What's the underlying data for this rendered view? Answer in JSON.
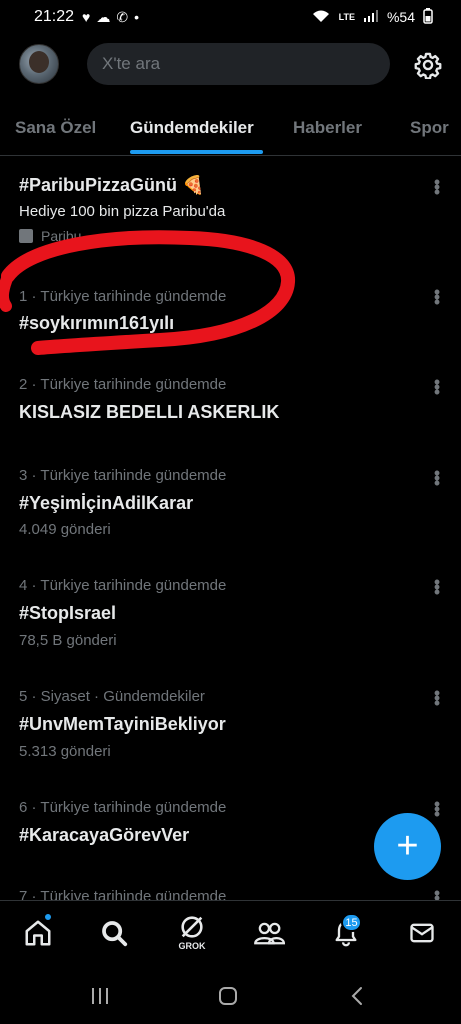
{
  "status_bar": {
    "time": "21:22",
    "battery": "%54",
    "network": "LTE"
  },
  "search": {
    "placeholder": "X'te ara"
  },
  "tabs": [
    {
      "label": "Sana Özel"
    },
    {
      "label": "Gündemdekiler"
    },
    {
      "label": "Haberler"
    },
    {
      "label": "Spor"
    }
  ],
  "trends": [
    {
      "title": "#ParibuPizzaGünü 🍕",
      "subtitle": "Hediye 100 bin pizza Paribu'da",
      "promoted": "Paribu"
    },
    {
      "context": "1 · Türkiye tarihinde gündemde",
      "title": "#soykırımın161yılı"
    },
    {
      "context": "2 · Türkiye tarihinde gündemde",
      "title": "KISLASIZ BEDELLI ASKERLIK"
    },
    {
      "context": "3 · Türkiye tarihinde gündemde",
      "title": "#YeşimİçinAdilKarar",
      "posts": "4.049 gönderi"
    },
    {
      "context": "4 · Türkiye tarihinde gündemde",
      "title": "#StopIsrael",
      "posts": "78,5 B gönderi"
    },
    {
      "context": "5 · Siyaset · Gündemdekiler",
      "title": "#UnvMemTayiniBekliyor",
      "posts": "5.313 gönderi"
    },
    {
      "context": "6 · Türkiye tarihinde gündemde",
      "title": "#KaracayaGörevVer"
    },
    {
      "context": "7 · Türkiye tarihinde gündemde"
    }
  ],
  "bottom_nav": {
    "grok_label": "GROK",
    "notification_count": "15"
  },
  "colors": {
    "accent": "#1d9bf0",
    "background": "#000000",
    "annotation": "#e8141c"
  },
  "icons": [
    "home-icon",
    "search-icon",
    "grok-icon",
    "communities-icon",
    "bell-icon",
    "mail-icon",
    "gear-icon",
    "plus-icon"
  ]
}
